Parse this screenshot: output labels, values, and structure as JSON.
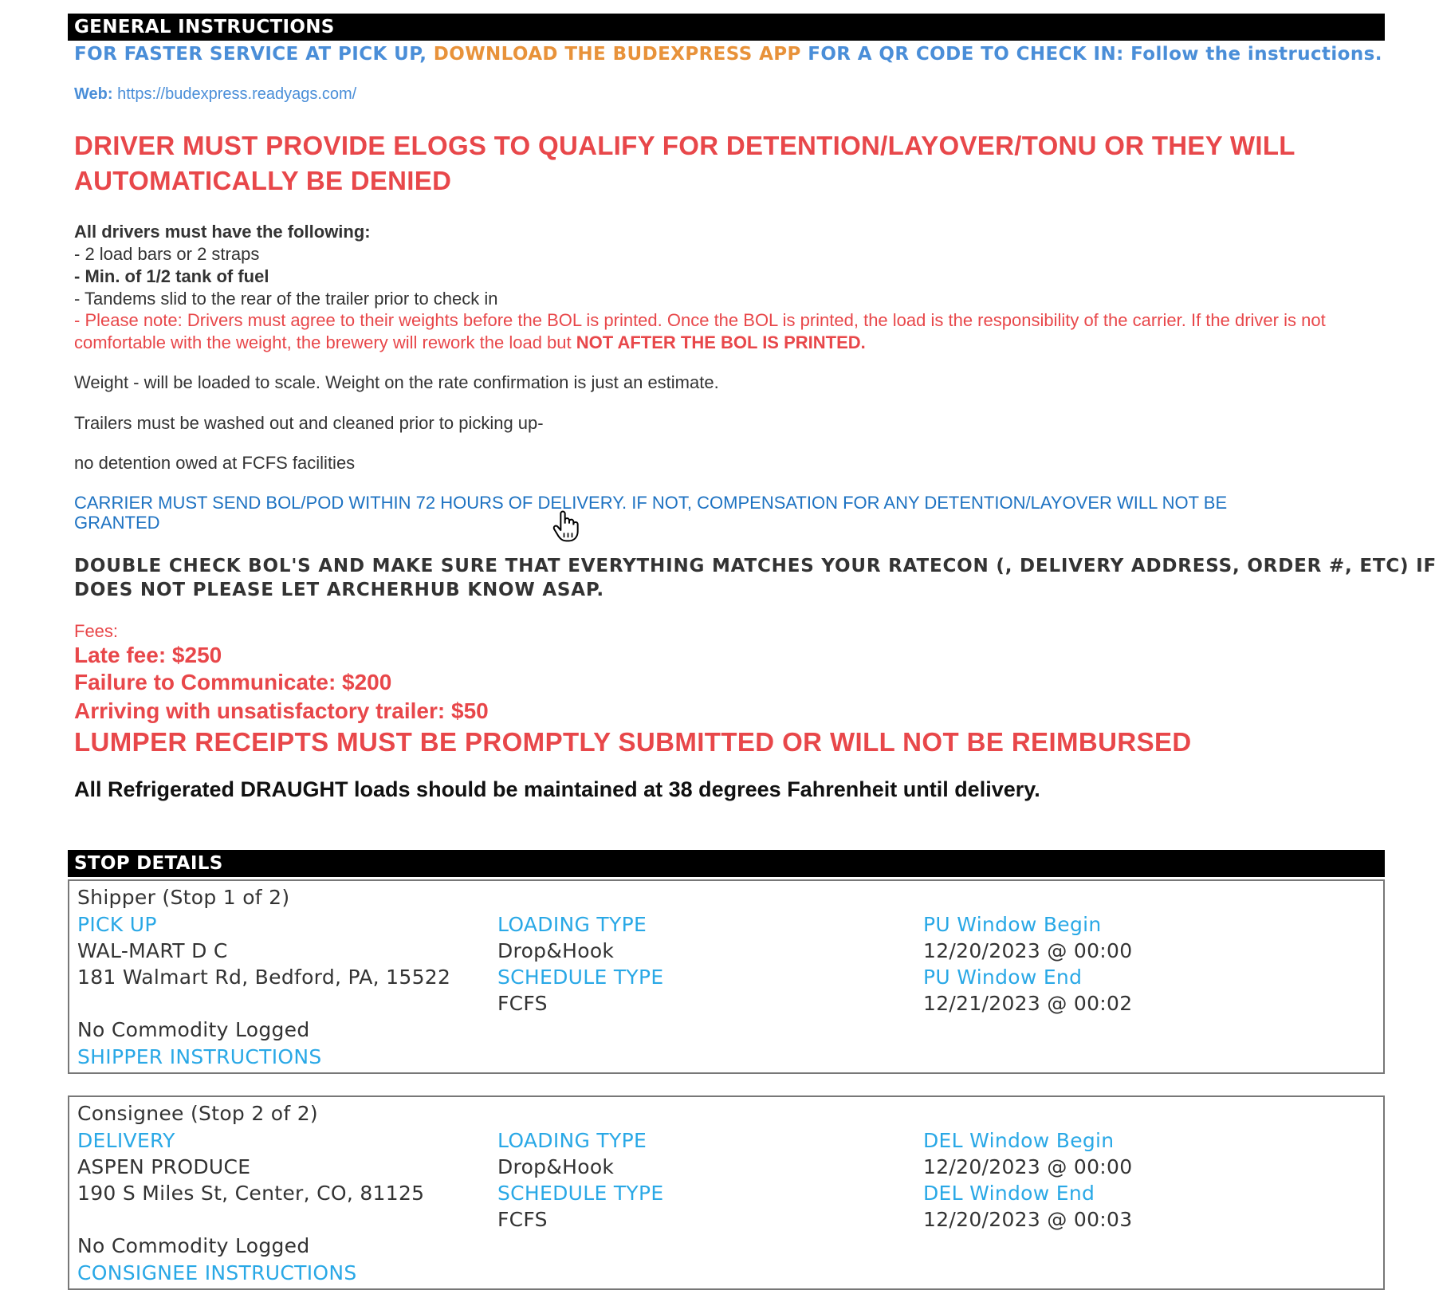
{
  "general": {
    "header": "GENERAL INSTRUCTIONS",
    "app_line": {
      "part1": "FOR FASTER SERVICE AT PICK UP, ",
      "part2": "DOWNLOAD THE BUDEXPRESS APP",
      "part3": " FOR A QR CODE TO CHECK IN: Follow the instructions."
    },
    "web_label": "Web: ",
    "web_url": "https://budexpress.readyags.com/",
    "elogs_line1": "DRIVER MUST PROVIDE ELOGS TO QUALIFY FOR  DETENTION/LAYOVER/TONU OR THEY WILL",
    "elogs_line2": "AUTOMATICALLY BE DENIED",
    "req_heading": "All drivers must have the following:",
    "req_items": [
      "- 2 load bars or 2 straps",
      "- Min. of 1/2 tank of fuel",
      "- Tandems slid to the rear of the trailer prior to check in"
    ],
    "note_line1": "- Please note: Drivers must agree to their weights before the BOL is printed. Once the BOL is printed, the load is the responsibility of the carrier. If the driver is not",
    "note_line2a": "comfortable with the weight, the brewery will rework the load but ",
    "note_line2b": "NOT AFTER THE BOL IS PRINTED.",
    "weight_line": "Weight - will be loaded to scale. Weight on the rate confirmation is just an estimate.",
    "trailer_line": "Trailers must be washed out and cleaned prior to picking up-",
    "detention_line": "no detention owed at FCFS facilities",
    "carrier_line1": "CARRIER MUST SEND BOL/POD WITHIN 72 HOURS OF DELIVERY. IF NOT, COMPENSATION FOR  ANY DETENTION/LAYOVER WILL NOT BE",
    "carrier_line2": "GRANTED",
    "double_line1": "DOUBLE CHECK BOL'S AND MAKE SURE THAT EVERYTHING MATCHES YOUR RATECON (, DELIVERY ADDRESS, ORDER #, ETC)  IF I",
    "double_line2": "DOES NOT PLEASE LET ARCHERHUB KNOW ASAP.",
    "fees_label": "Fees:",
    "fees": [
      "Late fee: $250",
      "Failure to Communicate: $200",
      "Arriving with unsatisfactory trailer: $50"
    ],
    "lumper_line": "LUMPER RECEIPTS MUST BE PROMPTLY SUBMITTED OR WILL NOT BE REIMBURSED",
    "draught_line": "All Refrigerated DRAUGHT loads should be maintained at 38 degrees Fahrenheit until delivery."
  },
  "stops": {
    "header": "STOP DETAILS",
    "list": [
      {
        "title": "Shipper (Stop 1 of 2)",
        "type_label": "PICK UP",
        "name": "WAL-MART D C",
        "address": "181 Walmart Rd, Bedford, PA, 15522",
        "commodity": "No Commodity Logged",
        "instructions_link": "SHIPPER INSTRUCTIONS",
        "loading_type_label": "LOADING TYPE",
        "loading_type": "Drop&Hook",
        "schedule_type_label": "SCHEDULE TYPE",
        "schedule_type": "FCFS",
        "window_begin_label": "PU Window Begin",
        "window_begin": "12/20/2023 @ 00:00",
        "window_end_label": "PU Window End",
        "window_end": "12/21/2023 @ 00:02"
      },
      {
        "title": "Consignee (Stop 2 of 2)",
        "type_label": "DELIVERY",
        "name": "ASPEN PRODUCE",
        "address": "190 S Miles St, Center, CO, 81125",
        "commodity": "No Commodity Logged",
        "instructions_link": "CONSIGNEE INSTRUCTIONS",
        "loading_type_label": "LOADING TYPE",
        "loading_type": "Drop&Hook",
        "schedule_type_label": "SCHEDULE TYPE",
        "schedule_type": "FCFS",
        "window_begin_label": "DEL Window Begin",
        "window_begin": "12/20/2023 @ 00:00",
        "window_end_label": "DEL Window End",
        "window_end": "12/20/2023 @ 00:03"
      }
    ]
  },
  "icons": {
    "cursor": "hand-pointer-icon"
  },
  "colors": {
    "blue": "#4a8ed8",
    "orange": "#e8923a",
    "red": "#e8474a",
    "dark_blue": "#1d72c2",
    "cyan": "#29a8e6",
    "header_bg": "#000000"
  }
}
